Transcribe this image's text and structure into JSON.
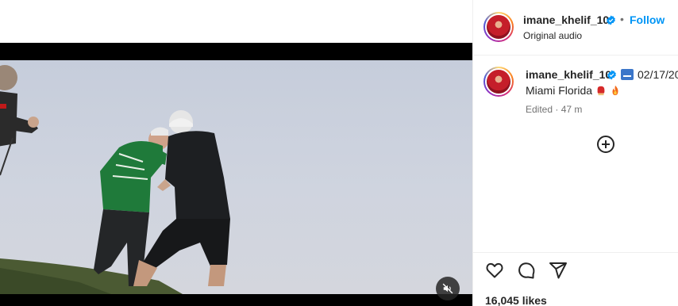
{
  "header": {
    "username": "imane_khelif_10",
    "separator": "•",
    "follow_label": "Follow",
    "audio": "Original audio"
  },
  "caption": {
    "username": "imane_khelif_10",
    "date": "02/17/20",
    "text": "Miami Florida",
    "emojis": [
      "boxing-glove",
      "fire"
    ],
    "edited": "Edited",
    "time_sep": "·",
    "time": "47 m"
  },
  "engagement": {
    "likes": "16,045 likes"
  },
  "icons": {
    "verified": "verified-badge-icon",
    "add": "add-comment-icon",
    "like": "heart-icon",
    "comment": "comment-icon",
    "share": "share-icon",
    "mute": "muted-speaker-icon"
  },
  "colors": {
    "follow": "#0095f6",
    "verified": "#0095f6",
    "text": "#262626",
    "muted_text": "#737373",
    "divider": "#efefef"
  }
}
